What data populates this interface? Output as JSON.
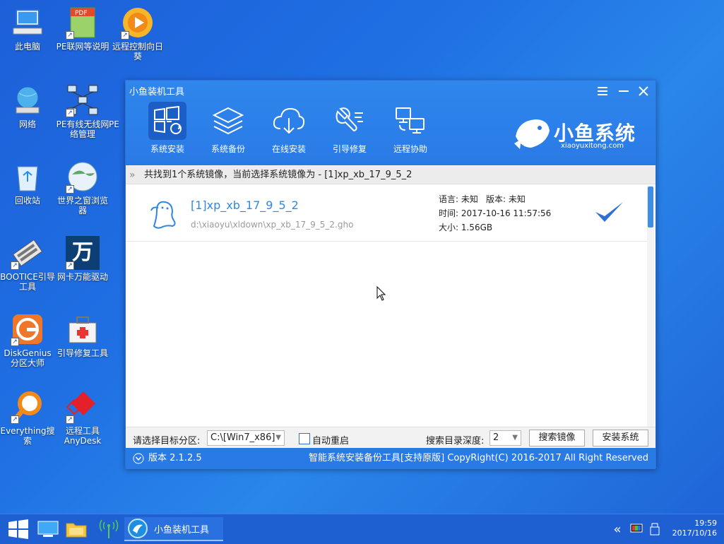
{
  "desktop": {
    "icons": [
      {
        "label": "此电脑"
      },
      {
        "label": "PE联网等说明"
      },
      {
        "label": "远程控制向日葵"
      },
      {
        "label": "网络"
      },
      {
        "label": "PE有线无线网络管理"
      },
      {
        "label": "PE"
      },
      {
        "label": "回收站"
      },
      {
        "label": "世界之窗浏览器"
      },
      {
        "label": "BOOTICE引导工具"
      },
      {
        "label": "网卡万能驱动"
      },
      {
        "label": "DiskGenius分区大师"
      },
      {
        "label": "引导修复工具"
      },
      {
        "label": "Everything搜索"
      },
      {
        "label": "远程工具AnyDesk"
      }
    ]
  },
  "window": {
    "title": "小鱼装机工具",
    "toolbar": [
      {
        "label": "系统安装"
      },
      {
        "label": "系统备份"
      },
      {
        "label": "在线安装"
      },
      {
        "label": "引导修复"
      },
      {
        "label": "远程协助"
      }
    ],
    "brand": {
      "name": "小鱼系统",
      "url": "xiaoyuxitong.com"
    },
    "info": "共找到1个系统镜像，当前选择系统镜像为 - [1]xp_xb_17_9_5_2",
    "image": {
      "name": "[1]xp_xb_17_9_5_2",
      "path": "d:\\xiaoyu\\xldown\\xp_xb_17_9_5_2.gho",
      "lang": "语言: 未知",
      "version": "版本: 未知",
      "time": "时间: 2017-10-16 11:57:56",
      "size": "大小: 1.56GB"
    },
    "controls": {
      "target_label": "请选择目标分区:",
      "target_value": "C:\\[Win7_x86]",
      "auto_restart": "自动重启",
      "depth_label": "搜索目录深度:",
      "depth_value": "2",
      "search_button": "搜索镜像",
      "install_button": "安装系统"
    },
    "status": {
      "version": "版本 2.1.2.5",
      "copyright": "智能系统安装备份工具[支持原版]  CopyRight(C) 2016-2017 All Right Reserved"
    }
  },
  "taskbar": {
    "app_label": "小鱼装机工具",
    "time": "19:59",
    "date": "2017/10/16"
  },
  "colors": {
    "accent": "#2a7ae6",
    "link": "#2f87e3"
  }
}
